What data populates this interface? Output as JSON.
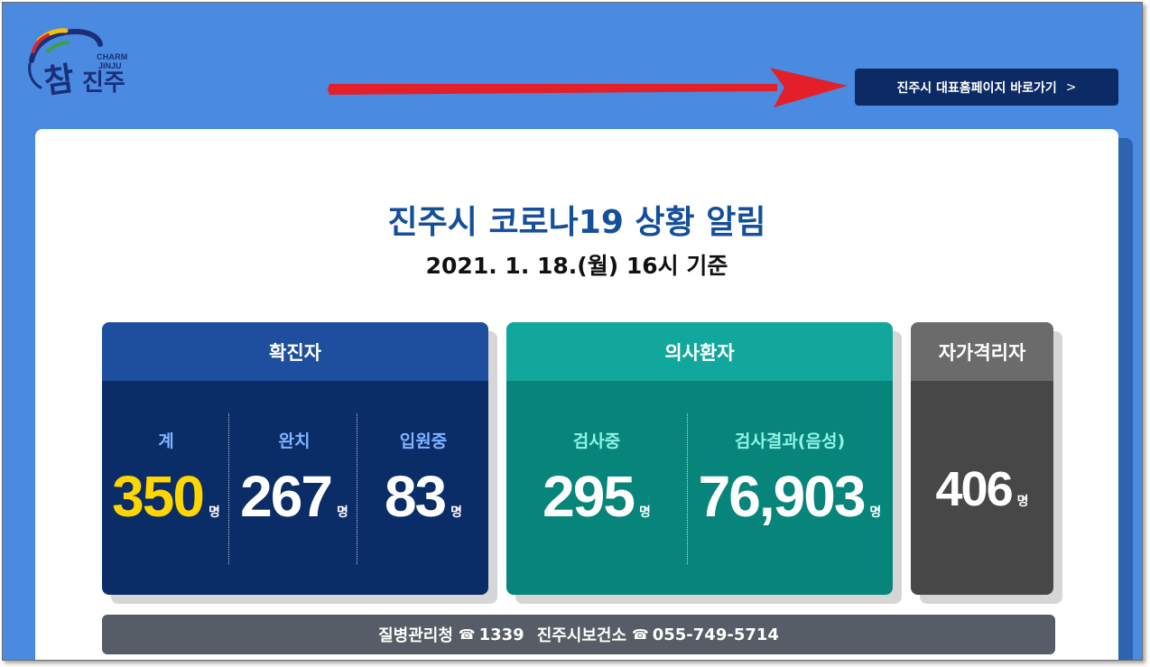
{
  "logo": {
    "charm": "CHARM",
    "jinju_en": "JINJU",
    "han": "참",
    "jinju_ko": "진주",
    "colors": {
      "navy": "#1a2f78",
      "yellow": "#f2c200",
      "red": "#d8262c",
      "green": "#3aa141"
    }
  },
  "header": {
    "home_button_label": "진주시 대표홈페이지 바로가기",
    "home_button_icon": "chevron-right-icon",
    "annotation_arrow_color": "#e3202a"
  },
  "main": {
    "title": "진주시 코로나19 상황 알림",
    "subtitle": "2021. 1. 18.(월) 16시 기준"
  },
  "cards": {
    "confirmed": {
      "header": "확진자",
      "header_color": "#1e4e9e",
      "body_color": "#0a2c67",
      "items": [
        {
          "label": "계",
          "value": "350",
          "unit": "명",
          "label_color": "#7fb4ff",
          "value_color": "#ffd600"
        },
        {
          "label": "완치",
          "value": "267",
          "unit": "명",
          "label_color": "#7fb4ff",
          "value_color": "#ffffff"
        },
        {
          "label": "입원중",
          "value": "83",
          "unit": "명",
          "label_color": "#7fb4ff",
          "value_color": "#ffffff"
        }
      ]
    },
    "suspected": {
      "header": "의사환자",
      "header_color": "#12a79c",
      "body_color": "#07857b",
      "items": [
        {
          "label": "검사중",
          "value": "295",
          "unit": "명",
          "label_color": "#8ff3e4",
          "value_color": "#ffffff"
        },
        {
          "label": "검사결과(음성)",
          "value": "76,903",
          "unit": "명",
          "label_color": "#8ff3e4",
          "value_color": "#ffffff"
        }
      ]
    },
    "self_quarantine": {
      "header": "자가격리자",
      "header_color": "#6b6b6b",
      "body_color": "#474747",
      "items": [
        {
          "label": "",
          "value": "406",
          "unit": "명",
          "value_color": "#ffffff"
        }
      ]
    }
  },
  "info_bar": {
    "org1": "질병관리청",
    "phone_icon": "phone-icon",
    "phone_glyph": "☎",
    "tel1": "1339",
    "org2": "진주시보건소",
    "tel2": "055-749-5714"
  }
}
